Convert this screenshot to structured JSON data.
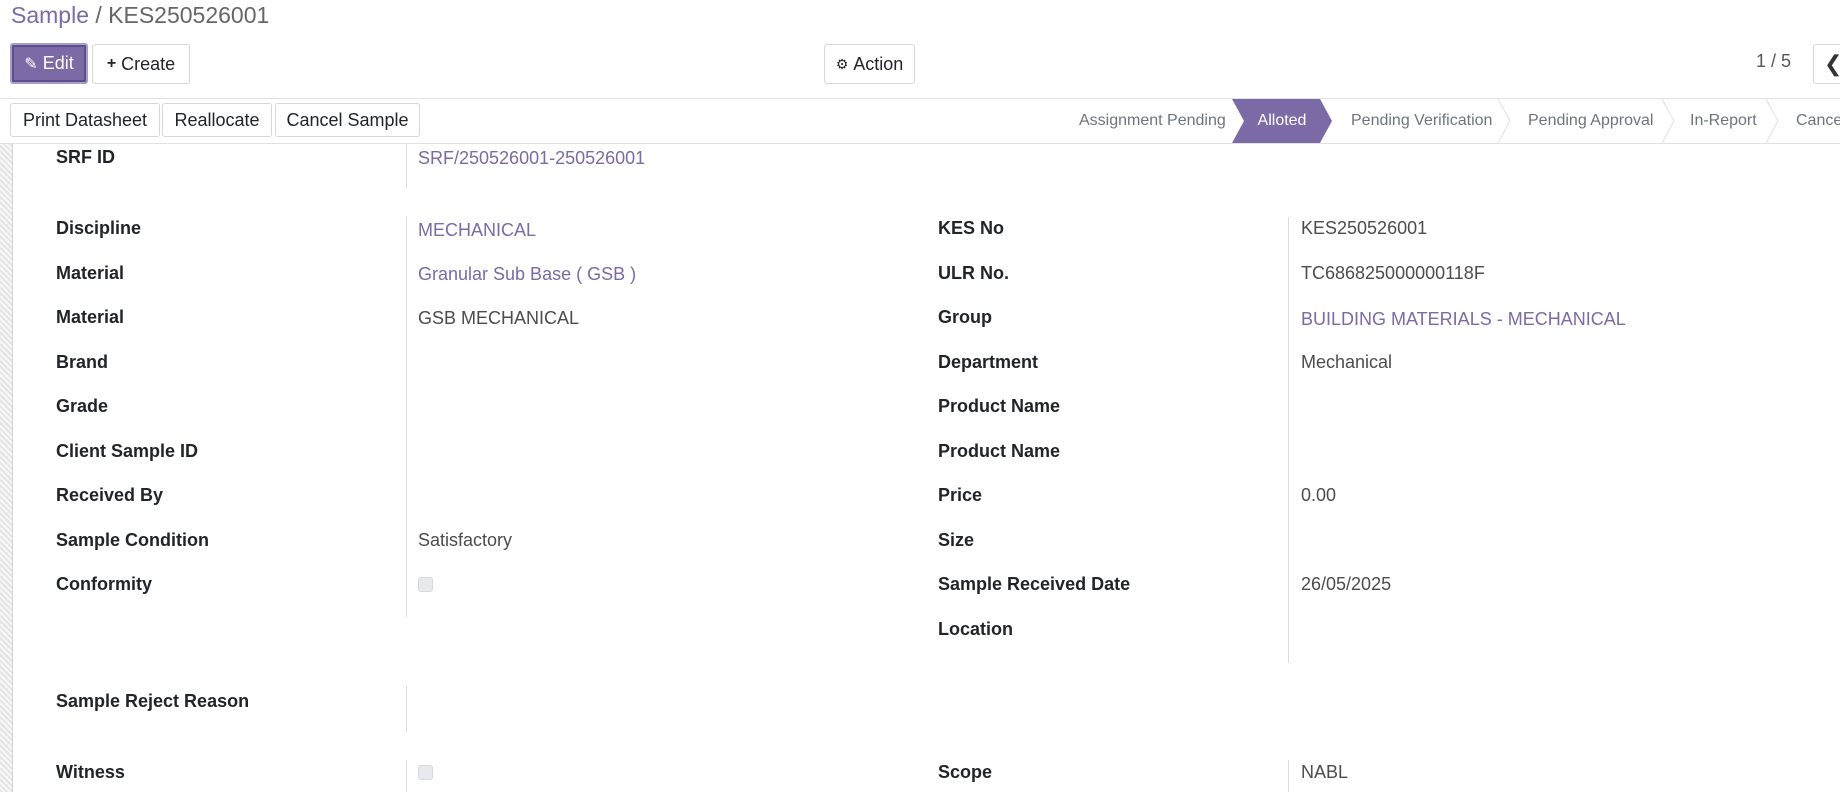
{
  "breadcrumb": {
    "parent": "Sample",
    "separator": " / ",
    "current": "KES250526001"
  },
  "toolbar": {
    "edit_label": "Edit",
    "create_label": "Create",
    "action_label": "Action"
  },
  "pager": {
    "value": "1 / 5"
  },
  "statusbar": {
    "buttons": [
      "Print Datasheet",
      "Reallocate",
      "Cancel Sample"
    ],
    "stages": [
      "Assignment Pending",
      "Alloted",
      "Pending Verification",
      "Pending Approval",
      "In-Report",
      "Cancel"
    ],
    "active_stage": "Alloted"
  },
  "form": {
    "srf_id": {
      "label": "SRF ID",
      "value": "SRF/250526001-250526001"
    },
    "left": [
      {
        "label": "Discipline",
        "value": "MECHANICAL"
      },
      {
        "label": "Material",
        "value": "Granular Sub Base ( GSB )"
      },
      {
        "label": "Material",
        "value": "GSB MECHANICAL"
      },
      {
        "label": "Brand",
        "value": ""
      },
      {
        "label": "Grade",
        "value": ""
      },
      {
        "label": "Client Sample ID",
        "value": ""
      },
      {
        "label": "Received By",
        "value": ""
      },
      {
        "label": "Sample Condition",
        "value": "Satisfactory"
      },
      {
        "label": "Conformity",
        "value": ""
      }
    ],
    "right": [
      {
        "label": "KES No",
        "value": "KES250526001"
      },
      {
        "label": "ULR No.",
        "value": "TC686825000000118F"
      },
      {
        "label": "Group",
        "value": "BUILDING MATERIALS - MECHANICAL"
      },
      {
        "label": "Department",
        "value": "Mechanical"
      },
      {
        "label": "Product Name",
        "value": ""
      },
      {
        "label": "Product Name",
        "value": ""
      },
      {
        "label": "Price",
        "value": "0.00"
      },
      {
        "label": "Size",
        "value": ""
      },
      {
        "label": "Sample Received Date",
        "value": "26/05/2025"
      },
      {
        "label": "Location",
        "value": ""
      }
    ],
    "reject_reason": {
      "label": "Sample Reject Reason",
      "value": ""
    },
    "witness": {
      "label": "Witness",
      "checked": false
    },
    "conformity_checked": false,
    "scope": {
      "label": "Scope",
      "value": "NABL"
    }
  },
  "colors": {
    "accent": "#7c6aa6",
    "border": "#dee2e6"
  },
  "icons": {
    "edit": "pencil-icon",
    "create": "plus-icon",
    "action": "gear-icon",
    "prev": "chevron-left-icon"
  }
}
